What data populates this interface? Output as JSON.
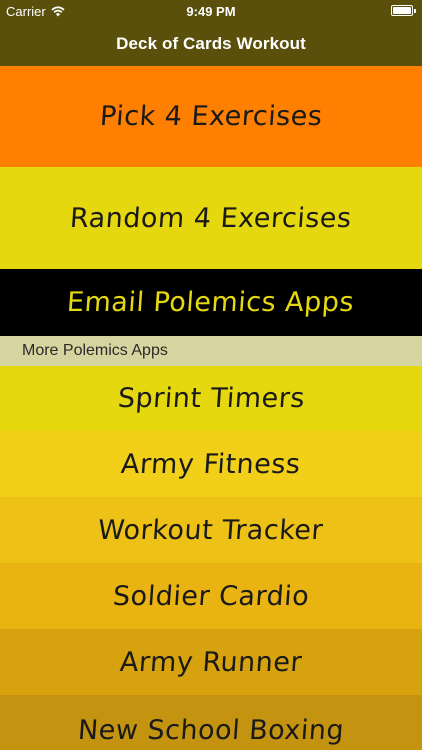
{
  "status_bar": {
    "carrier": "Carrier",
    "time": "9:49 PM",
    "wifi_icon": "wifi-icon",
    "battery_icon": "battery-icon"
  },
  "nav": {
    "title": "Deck of Cards Workout"
  },
  "menu": {
    "pick": "Pick 4 Exercises",
    "random": "Random 4 Exercises",
    "email": "Email Polemics Apps"
  },
  "section": {
    "header": "More Polemics Apps"
  },
  "apps": {
    "sprint": "Sprint Timers",
    "army_fitness": "Army Fitness",
    "workout_tracker": "Workout Tracker",
    "soldier_cardio": "Soldier Cardio",
    "army_runner": "Army Runner",
    "boxing": "New School Boxing"
  },
  "colors": {
    "nav_background": "#5a500b",
    "pick_row": "#ff7f00",
    "random_row": "#e6d80f",
    "email_row": "#000000",
    "email_text": "#e6d80f",
    "section_header": "#d6d5a0",
    "sprint_row": "#e6d80f",
    "army_fitness_row": "#f2d01a",
    "workout_tracker_row": "#eec116",
    "soldier_cardio_row": "#e9b312",
    "army_runner_row": "#d6a30e",
    "boxing_row": "#c49410"
  }
}
